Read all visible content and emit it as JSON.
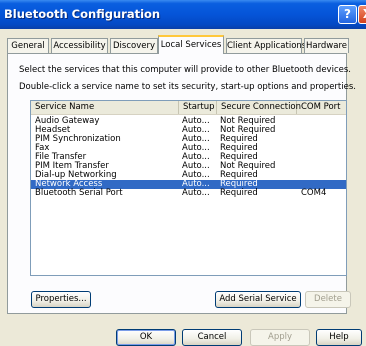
{
  "window": {
    "title": "Bluetooth Configuration",
    "help_glyph": "?",
    "close_glyph": "X"
  },
  "tabs": [
    {
      "label": "General"
    },
    {
      "label": "Accessibility"
    },
    {
      "label": "Discovery"
    },
    {
      "label": "Local Services",
      "active": true
    },
    {
      "label": "Client Applications"
    },
    {
      "label": "Hardware"
    }
  ],
  "description": {
    "line1": "Select the services that this computer will provide to other Bluetooth devices.",
    "line2": "Double-click a service name to set its security, start-up options and properties."
  },
  "services": {
    "columns": [
      "Service Name",
      "Startup",
      "Secure Connection",
      "COM Port"
    ],
    "rows": [
      {
        "name": "Audio Gateway",
        "startup": "Auto...",
        "secure": "Not Required",
        "com": ""
      },
      {
        "name": "Headset",
        "startup": "Auto...",
        "secure": "Not Required",
        "com": ""
      },
      {
        "name": "PIM Synchronization",
        "startup": "Auto...",
        "secure": "Required",
        "com": ""
      },
      {
        "name": "Fax",
        "startup": "Auto...",
        "secure": "Required",
        "com": ""
      },
      {
        "name": "File Transfer",
        "startup": "Auto...",
        "secure": "Required",
        "com": ""
      },
      {
        "name": "PIM Item Transfer",
        "startup": "Auto...",
        "secure": "Not Required",
        "com": ""
      },
      {
        "name": "Dial-up Networking",
        "startup": "Auto...",
        "secure": "Required",
        "com": ""
      },
      {
        "name": "Network Access",
        "startup": "Auto...",
        "secure": "Required",
        "com": "",
        "selected": true
      },
      {
        "name": "Bluetooth Serial Port",
        "startup": "Auto...",
        "secure": "Required",
        "com": "COM4"
      }
    ]
  },
  "buttons": {
    "properties": "Properties...",
    "add_serial": "Add Serial Service",
    "delete": "Delete",
    "ok": "OK",
    "cancel": "Cancel",
    "apply": "Apply",
    "help": "Help"
  },
  "colors": {
    "selection": "#316ac5",
    "title_bar": "#0554d8",
    "active_tab_accent": "#ffc83c"
  }
}
